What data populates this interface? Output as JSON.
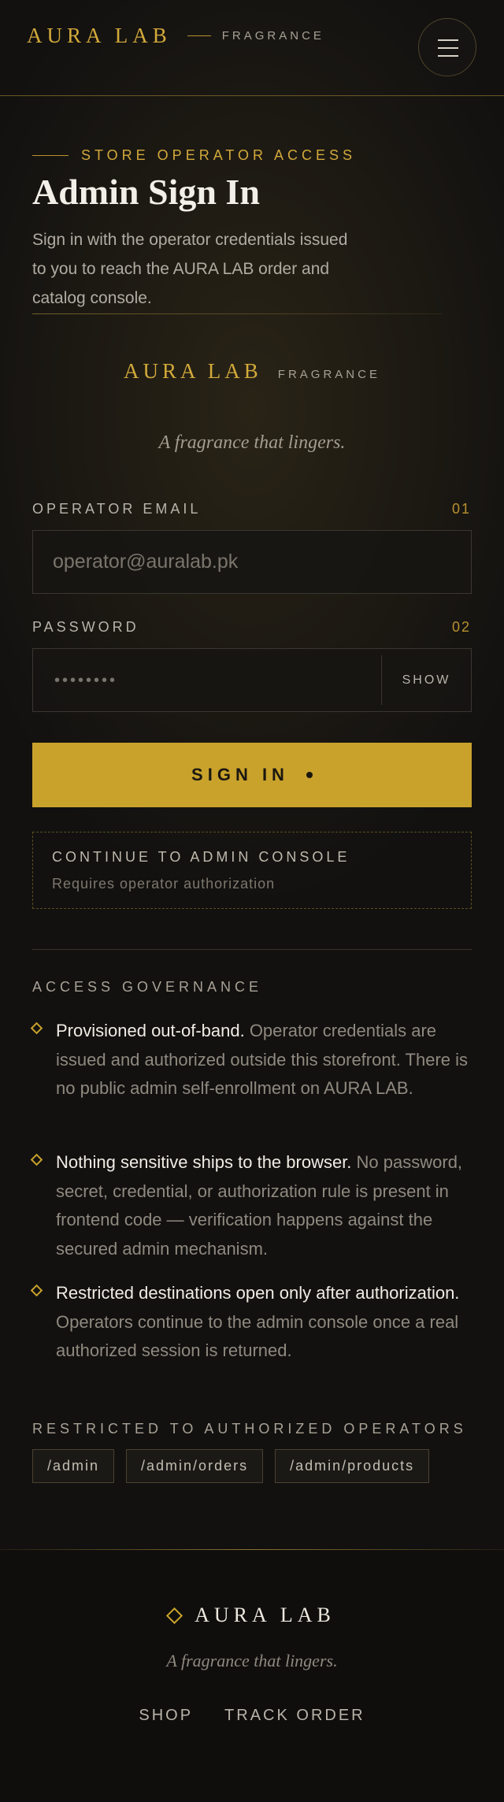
{
  "header": {
    "brand_name": "AURA LAB",
    "brand_sub": "FRAGRANCE",
    "menu_icon": "hamburger-icon"
  },
  "intro": {
    "eyebrow": "STORE OPERATOR ACCESS",
    "title": "Admin Sign In",
    "lede": "Sign in with the operator credentials issued to you to reach the AURA LAB order and catalog console."
  },
  "card": {
    "brand_name": "AURA LAB",
    "brand_sub": "FRAGRANCE",
    "tagline": "A fragrance that lingers."
  },
  "form": {
    "email_label": "OPERATOR EMAIL",
    "email_num": "01",
    "email_placeholder": "operator@auralab.pk",
    "password_label": "PASSWORD",
    "password_num": "02",
    "password_mask": "••••••••",
    "show_label": "SHOW",
    "signin_label": "SIGN IN"
  },
  "console": {
    "title": "CONTINUE TO ADMIN CONSOLE",
    "subtitle": "Requires operator authorization"
  },
  "governance": {
    "title": "ACCESS GOVERNANCE",
    "items": [
      {
        "lead": "Provisioned out-of-band.",
        "body": " Operator credentials are issued and authorized outside this storefront. There is no public admin self-enrollment on AURA LAB."
      },
      {
        "lead": "Nothing sensitive ships to the browser.",
        "body": " No password, secret, credential, or authorization rule is present in frontend code — verification happens against the secured admin mechanism."
      },
      {
        "lead": "Restricted destinations open only after authorization.",
        "body": " Operators continue to the admin console once a real authorized session is returned."
      }
    ]
  },
  "restricted": {
    "title": "RESTRICTED TO AUTHORIZED OPERATORS",
    "routes": [
      "/admin",
      "/admin/orders",
      "/admin/products"
    ]
  },
  "footer": {
    "brand_name": "AURA LAB",
    "tagline": "A fragrance that lingers.",
    "nav": [
      "SHOP",
      "TRACK ORDER"
    ]
  },
  "colors": {
    "accent_gold": "#c9a22c",
    "background": "#121110",
    "text_light": "#f2efe8"
  }
}
